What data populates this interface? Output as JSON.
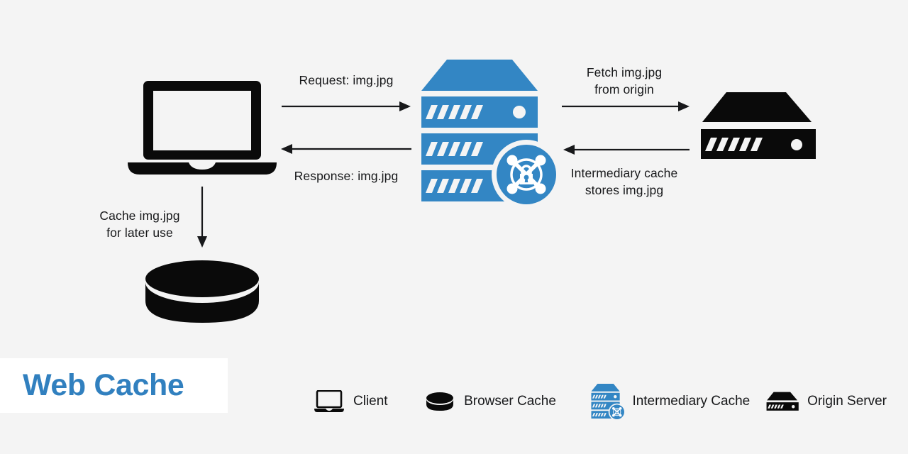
{
  "diagram": {
    "title": "Web Cache",
    "background_color": "#f4f4f4",
    "accent_color": "#3386c4",
    "title_color": "#3180bf",
    "text_color": "#17181a",
    "title_plate_color": "#ffffff"
  },
  "nodes": {
    "client": {
      "name": "Client",
      "icon": "laptop-icon",
      "color": "#000000"
    },
    "browser_cache": {
      "name": "Browser Cache",
      "icon": "database-cylinder-icon",
      "color": "#000000"
    },
    "intermediary_cache": {
      "name": "Intermediary Cache",
      "icon": "blue-server-with-lock-badge-icon",
      "color": "#3386c4"
    },
    "origin_server": {
      "name": "Origin Server",
      "icon": "server-rack-icon",
      "color": "#000000"
    }
  },
  "flows": [
    {
      "id": "request",
      "label": "Request: img.jpg",
      "direction": "right",
      "from": "client",
      "to": "intermediary_cache",
      "label_position": "above"
    },
    {
      "id": "response",
      "label": "Response: img.jpg",
      "direction": "left",
      "from": "intermediary_cache",
      "to": "client",
      "label_position": "below"
    },
    {
      "id": "fetch",
      "label": "Fetch img.jpg\nfrom origin",
      "direction": "right",
      "from": "intermediary_cache",
      "to": "origin_server",
      "label_position": "above"
    },
    {
      "id": "store",
      "label": "Intermediary cache\nstores img.jpg",
      "direction": "left",
      "from": "origin_server",
      "to": "intermediary_cache",
      "label_position": "below"
    },
    {
      "id": "cache-local",
      "label": "Cache img.jpg\nfor later use",
      "direction": "down",
      "from": "client",
      "to": "browser_cache",
      "label_position": "left"
    }
  ],
  "legend": {
    "items": [
      {
        "label": "Client",
        "icon": "laptop-icon",
        "color": "#000000"
      },
      {
        "label": "Browser Cache",
        "icon": "database-cylinder-icon",
        "color": "#000000"
      },
      {
        "label": "Intermediary Cache",
        "icon": "blue-server-with-lock-badge-icon",
        "color": "#3386c4"
      },
      {
        "label": "Origin Server",
        "icon": "server-rack-icon",
        "color": "#000000"
      }
    ]
  }
}
